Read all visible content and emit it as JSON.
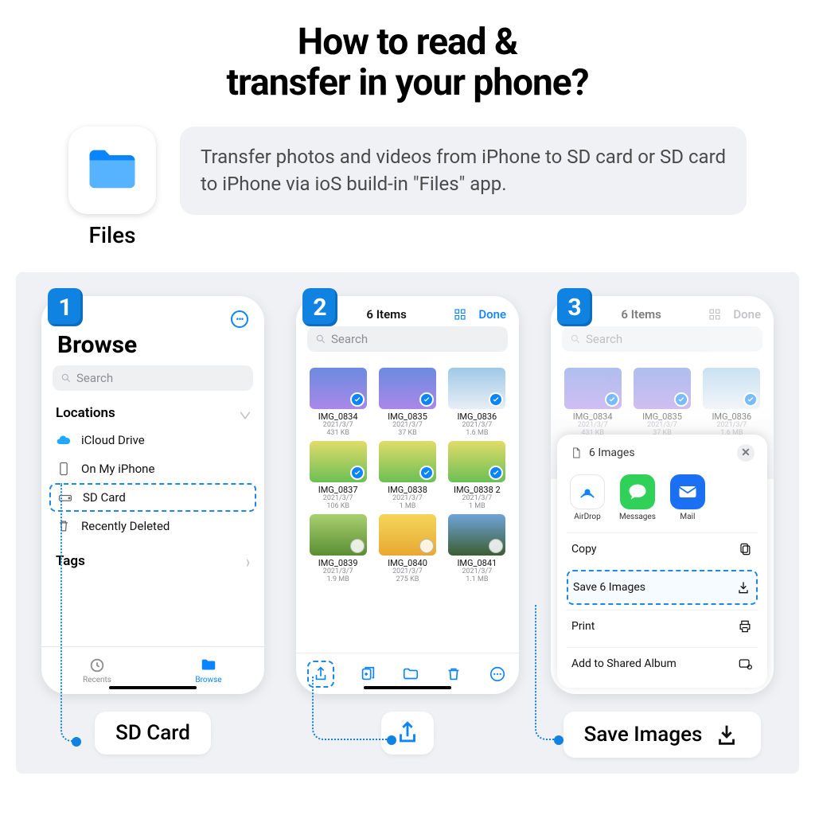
{
  "title_l1": "How to read &",
  "title_l2": "transfer in your phone?",
  "app_label": "Files",
  "description": "Transfer photos and videos from iPhone to SD card or SD card to iPhone via ioS build-in \"Files\" app.",
  "steps": {
    "1": "1",
    "2": "2",
    "3": "3"
  },
  "callouts": {
    "c1": "SD Card",
    "c2": "",
    "c3": "Save Images"
  },
  "p1": {
    "title": "Browse",
    "search_ph": "Search",
    "locations_hd": "Locations",
    "tags_hd": "Tags",
    "loc": {
      "icloud": "iCloud Drive",
      "onphone": "On My iPhone",
      "sd": "SD Card",
      "deleted": "Recently Deleted"
    },
    "tabs": {
      "recents": "Recents",
      "browse": "Browse"
    }
  },
  "nav2": {
    "count": "6 Items",
    "done": "Done"
  },
  "search_ph": "Search",
  "files": [
    {
      "n": "IMG_0834",
      "d": "2021/3/7",
      "s": "431 KB",
      "cls": "flower",
      "sel": true
    },
    {
      "n": "IMG_0835",
      "d": "2021/3/7",
      "s": "37 KB",
      "cls": "flower",
      "sel": true
    },
    {
      "n": "IMG_0836",
      "d": "2021/3/7",
      "s": "1.6 MB",
      "cls": "snow",
      "sel": true
    },
    {
      "n": "IMG_0837",
      "d": "2021/3/7",
      "s": "106 KB",
      "cls": "field",
      "sel": true
    },
    {
      "n": "IMG_0838",
      "d": "2021/3/7",
      "s": "1 MB",
      "cls": "field",
      "sel": true
    },
    {
      "n": "IMG_0838 2",
      "d": "2021/3/7",
      "s": "1 MB",
      "cls": "field",
      "sel": true
    },
    {
      "n": "IMG_0839",
      "d": "2021/3/7",
      "s": "1.9 MB",
      "cls": "forest",
      "sel": false
    },
    {
      "n": "IMG_0840",
      "d": "2021/3/7",
      "s": "275 KB",
      "cls": "sun",
      "sel": false
    },
    {
      "n": "IMG_0841",
      "d": "2021/3/7",
      "s": "1.1 MB",
      "cls": "mount",
      "sel": false
    }
  ],
  "files3": [
    {
      "n": "IMG_0834",
      "d": "2021/3/7",
      "s": "431 KB",
      "cls": "flower",
      "sel": true
    },
    {
      "n": "IMG_0835",
      "d": "2021/3/7",
      "s": "37 KB",
      "cls": "flower",
      "sel": true
    },
    {
      "n": "IMG_0836",
      "d": "2021/3/7",
      "s": "1.6 MB",
      "cls": "snow",
      "sel": true
    }
  ],
  "sheet": {
    "hd": "6 Images",
    "apps": {
      "airdrop": "AirDrop",
      "messages": "Messages",
      "mail": "Mail"
    },
    "rows": {
      "copy": "Copy",
      "save": "Save 6 Images",
      "print": "Print",
      "shared": "Add to Shared Album"
    }
  }
}
